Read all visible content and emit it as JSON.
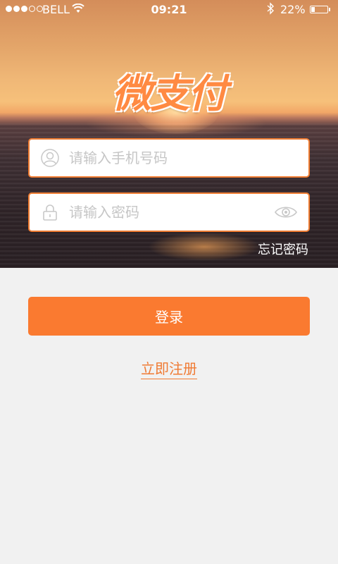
{
  "status_bar": {
    "carrier": "BELL",
    "time": "09:21",
    "battery_percent_text": "22%",
    "battery_level": 0.22,
    "signal_dots": [
      "full",
      "full",
      "full",
      "empty",
      "empty"
    ]
  },
  "logo": {
    "text": "微支付"
  },
  "login_form": {
    "phone": {
      "placeholder": "请输入手机号码",
      "value": "",
      "icon": "user-icon"
    },
    "password": {
      "placeholder": "请输入密码",
      "value": "",
      "icon": "lock-icon",
      "toggle_icon": "eye-icon"
    },
    "forgot_password": "忘记密码",
    "login_button": "登录",
    "register_link": "立即注册"
  },
  "colors": {
    "accent": "#fa7a30",
    "input_border": "#f07d33",
    "background": "#f1f1f1",
    "placeholder": "#c6c6c6"
  }
}
